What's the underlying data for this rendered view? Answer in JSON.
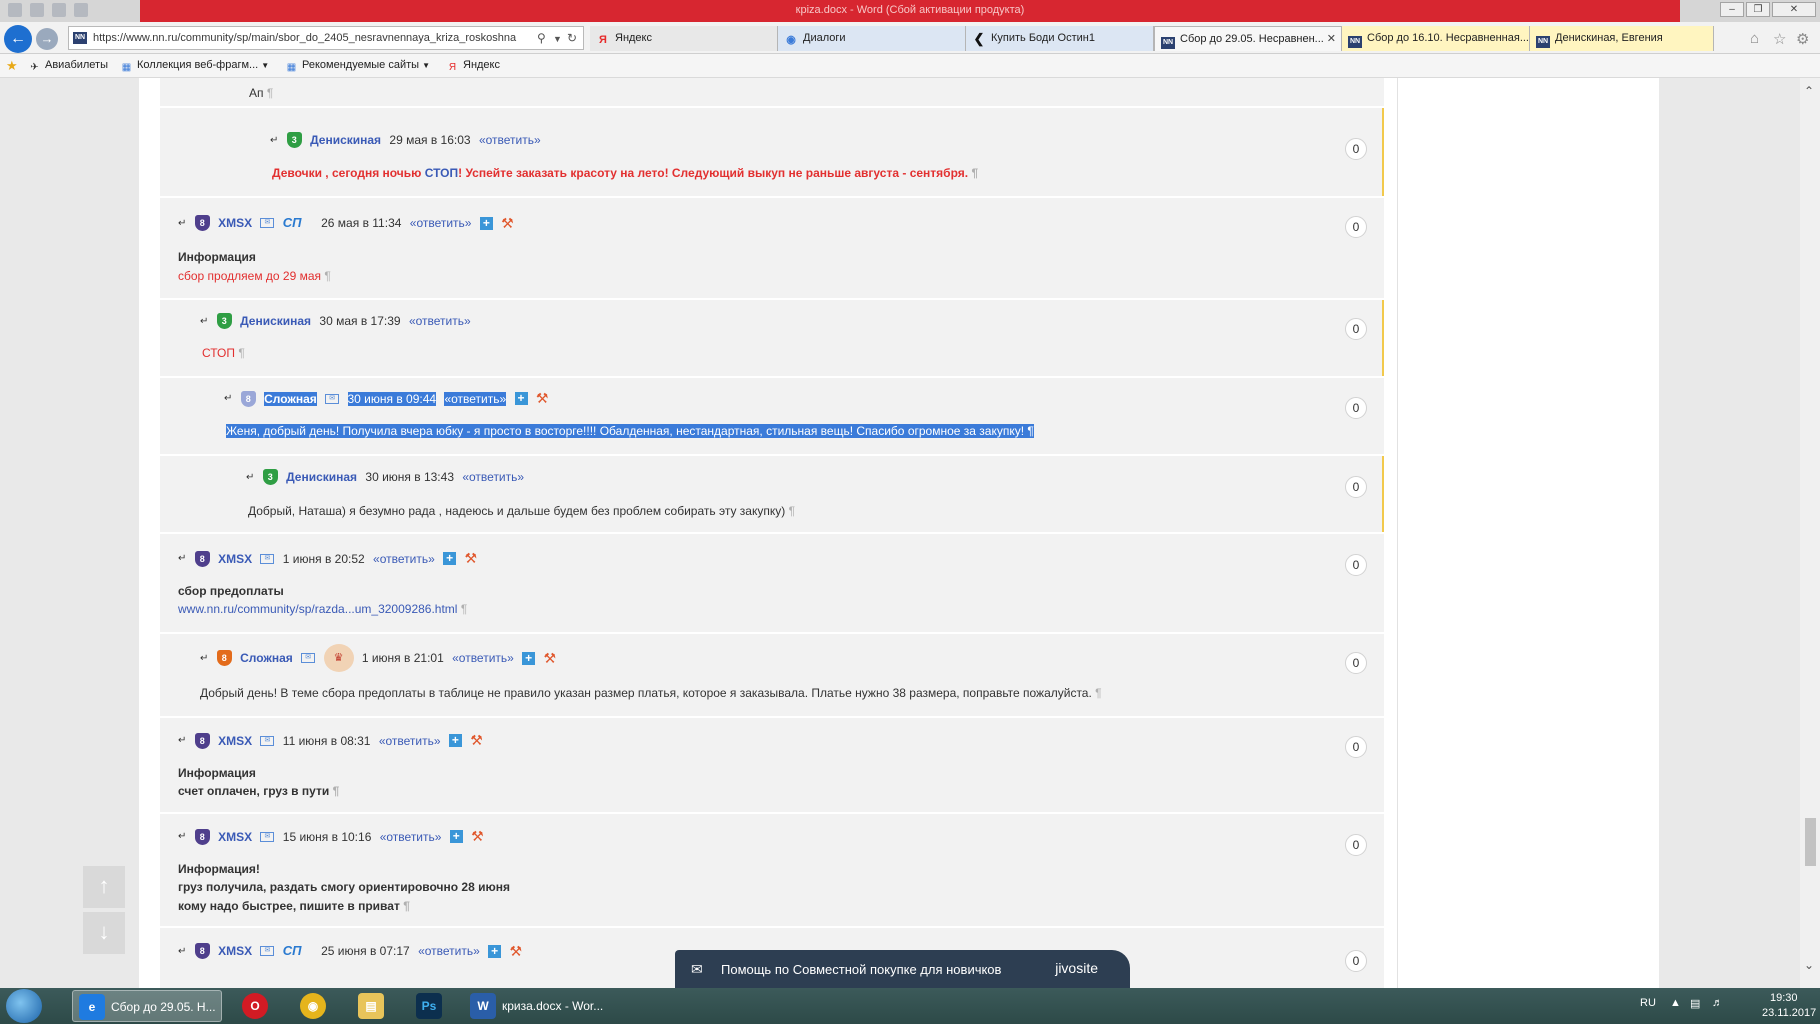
{
  "window": {
    "title": "крiza.docx - Word (Сбой активации продукта)"
  },
  "browser": {
    "address": "https://www.nn.ru/community/sp/main/sbor_do_2405_nesravnennaya_kriza_roskoshna",
    "favicon": "NN",
    "tabs": [
      {
        "label": "Яндекс",
        "icon": "Я"
      },
      {
        "label": "Диалоги",
        "icon": "chat-icon"
      },
      {
        "label": "Купить Боди Остин1",
        "icon": "back-arrow-icon"
      },
      {
        "label": "Сбор до 29.05. Несравнен...",
        "icon": "NN",
        "active": true
      },
      {
        "label": "Сбор до 16.10. Несравненная...",
        "icon": "NN"
      },
      {
        "label": "Денискиная, Евгения",
        "icon": "NN"
      }
    ],
    "favorites": [
      {
        "label": "Авиабилеты"
      },
      {
        "label": "Коллекция веб-фрагм..."
      },
      {
        "label": "Рекомендуемые сайты"
      },
      {
        "label": "Яндекс"
      }
    ]
  },
  "comments": {
    "top_fragment": "Ап",
    "c1": {
      "user": "Денискиная",
      "badge": "3",
      "time": "29 мая в 16:03",
      "reply": "«ответить»",
      "text_red1": "Девочки , сегодня ночью",
      "text_blue": "СТОП",
      "text_red2": "! Успейте заказать красоту на лето! Следующий выкуп не раньше августа - сентября.",
      "score": "0"
    },
    "c2": {
      "user": "XMSX",
      "badge": "8",
      "logo": "СП",
      "time": "26 мая в 11:34",
      "reply": "«ответить»",
      "line1": "Информация",
      "line2": "сбор продляем до 29 мая",
      "score": "0"
    },
    "c3": {
      "user": "Денискиная",
      "badge": "3",
      "time": "30 мая в 17:39",
      "reply": "«ответить»",
      "text": "СТОП",
      "score": "0"
    },
    "c4": {
      "user": "Сложная",
      "badge": "8",
      "time": "30 июня в 09:44",
      "reply": "«ответить»",
      "text": "Женя, добрый день! Получила вчера юбку - я просто в восторге!!!! Обалденная, нестандартная, стильная вещь! Спасибо огромное за закупку!",
      "score": "0"
    },
    "c5": {
      "user": "Денискиная",
      "badge": "3",
      "time": "30 июня в 13:43",
      "reply": "«ответить»",
      "text": "Добрый, Наташа) я безумно рада , надеюсь и дальше будем без проблем собирать эту закупку)",
      "score": "0"
    },
    "c6": {
      "user": "XMSX",
      "badge": "8",
      "time": "1 июня в 20:52",
      "reply": "«ответить»",
      "line1": "сбор предоплаты",
      "link": "www.nn.ru/community/sp/razda...um_32009286.html",
      "score": "0"
    },
    "c7": {
      "user": "Сложная",
      "badge": "8",
      "time": "1 июня в 21:01",
      "reply": "«ответить»",
      "text": "Добрый день! В теме сбора предоплаты в таблице не правило указан размер платья, которое я заказывала. Платье нужно 38 размера, поправьте пожалуйста.",
      "score": "0"
    },
    "c8": {
      "user": "XMSX",
      "badge": "8",
      "time": "11 июня в 08:31",
      "reply": "«ответить»",
      "line1": "Информация",
      "line2": "счет оплачен, груз в пути",
      "score": "0"
    },
    "c9": {
      "user": "XMSX",
      "badge": "8",
      "time": "15 июня в 10:16",
      "reply": "«ответить»",
      "line1": "Информация!",
      "line2": "груз получила, раздать смогу ориентировочно 28 июня",
      "line3": "кому надо быстрее, пишите в приват",
      "score": "0"
    },
    "c10": {
      "user": "XMSX",
      "badge": "8",
      "logo": "СП",
      "time": "25 июня в 07:17",
      "reply": "«ответить»",
      "score": "0"
    }
  },
  "pilcrow": "¶",
  "jivo": {
    "text": "Помощь по Совместной покупке для новичков",
    "brand": "jivosite"
  },
  "taskbar": {
    "items": [
      {
        "label": "Сбор до 29.05. Н...",
        "icon": "ie-icon"
      },
      {
        "label": "",
        "icon": "opera-icon"
      },
      {
        "label": "",
        "icon": "chrome-icon"
      },
      {
        "label": "",
        "icon": "folder-icon"
      },
      {
        "label": "Ps",
        "icon": "photoshop-icon"
      },
      {
        "label": "криза.docx - Wor...",
        "icon": "word-icon"
      }
    ],
    "lang": "RU",
    "time": "19:30",
    "date": "23.11.2017"
  }
}
